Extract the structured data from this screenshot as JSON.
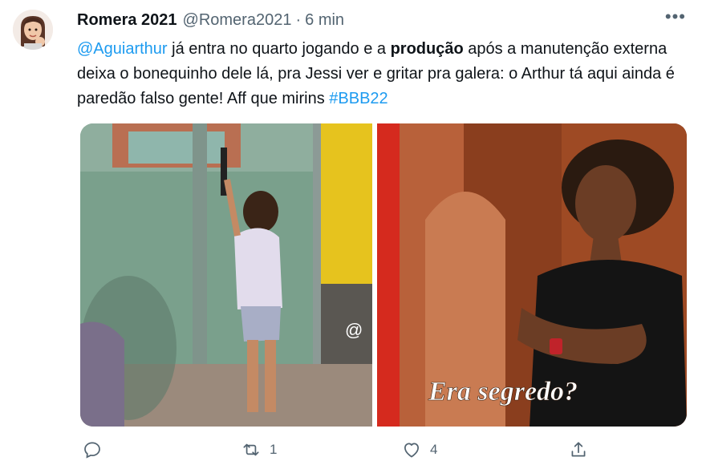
{
  "tweet": {
    "display_name": "Romera 2021",
    "handle": "@Romera2021",
    "separator": "·",
    "time": "6 min",
    "more_icon": "more-dots-icon",
    "text_parts": {
      "mention": "@Aguiarthur",
      "part1": " já entra no quarto jogando e a ",
      "bold": "produção",
      "part2": " após a manutenção externa deixa o bonequinho dele lá, pra Jessi ver e gritar pra galera: o Arthur tá aqui ainda é paredão falso gente! Aff que mirins ",
      "hashtag": "#BBB22"
    }
  },
  "media": {
    "left_watermark": "@",
    "right_caption": "Era segredo?"
  },
  "actions": {
    "reply_icon": "reply-icon",
    "retweet_icon": "retweet-icon",
    "retweet_count": "1",
    "like_icon": "heart-icon",
    "like_count": "4",
    "share_icon": "share-icon"
  },
  "colors": {
    "link": "#1d9bf0",
    "secondary_text": "#536471",
    "primary_text": "#0f1419"
  }
}
